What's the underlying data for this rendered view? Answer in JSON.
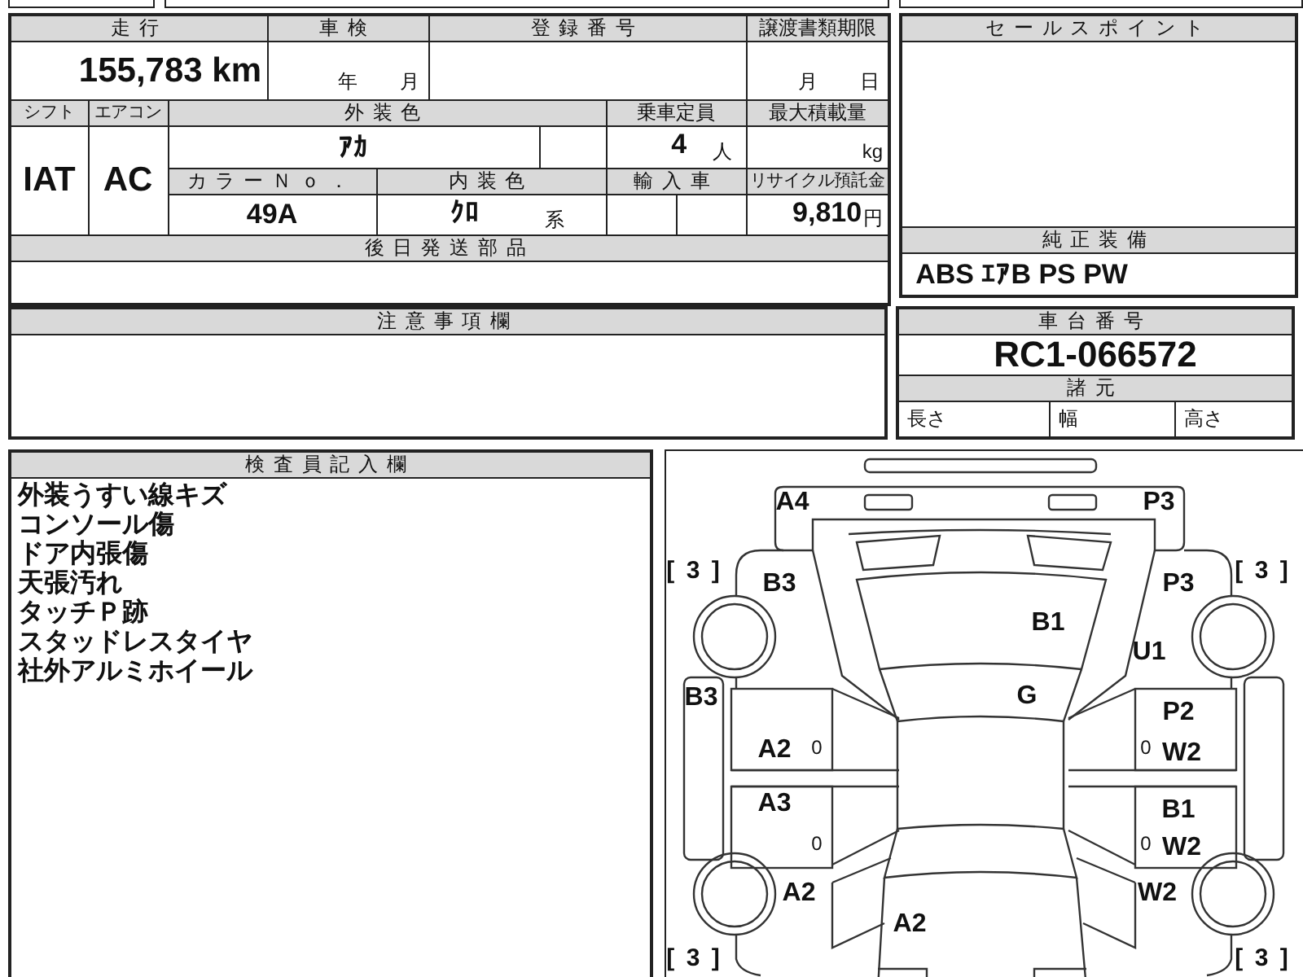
{
  "mileage": {
    "label": "走行",
    "value": "155,783 km"
  },
  "inspection": {
    "label": "車検",
    "year_unit": "年",
    "month_unit": "月"
  },
  "registration_number": {
    "label": "登録番号"
  },
  "transfer_deadline": {
    "label": "譲渡書類期限",
    "month_unit": "月",
    "day_unit": "日"
  },
  "shift": {
    "label": "シフト",
    "value": "IAT"
  },
  "air_conditioner": {
    "label": "エアコン",
    "value": "AC"
  },
  "exterior_color": {
    "label": "外装色",
    "value": "ｱｶ"
  },
  "capacity": {
    "label": "乗車定員",
    "value": "4",
    "unit": "人"
  },
  "max_load": {
    "label": "最大積載量",
    "unit": "kg"
  },
  "color_number": {
    "label": "カラーＮｏ．",
    "value": "49A"
  },
  "interior_color": {
    "label": "内装色",
    "value": "ｸﾛ",
    "suffix": "系"
  },
  "imported": {
    "label": "輸入車"
  },
  "recycling_fee": {
    "label": "リサイクル預託金",
    "value": "9,810",
    "unit": "円"
  },
  "later_shipped_parts": {
    "label": "後日発送部品"
  },
  "sales_points": {
    "label": "セールスポイント"
  },
  "standard_equipment": {
    "label": "純正装備",
    "value": "ABS ｴｱB PS PW"
  },
  "notes": {
    "label": "注意事項欄"
  },
  "chassis_number": {
    "label": "車台番号",
    "value": "RC1-066572"
  },
  "specifications": {
    "label": "諸元",
    "items": [
      "長さ",
      "幅",
      "高さ"
    ]
  },
  "inspector_notes": {
    "label": "検査員記入欄",
    "lines": [
      "外装うすい線キズ",
      "コンソール傷",
      "ドア内張傷",
      "天張汚れ",
      "タッチＰ跡",
      "スタッドレスタイヤ",
      "社外アルミホイール"
    ]
  },
  "damage_diagram": {
    "marks": [
      {
        "kind": "code",
        "text": "A4"
      },
      {
        "kind": "code",
        "text": "P3"
      },
      {
        "kind": "tread",
        "text": "[ 3 ]"
      },
      {
        "kind": "code",
        "text": "B3"
      },
      {
        "kind": "tread",
        "text": "[ 3 ]"
      },
      {
        "kind": "code",
        "text": "P3"
      },
      {
        "kind": "code",
        "text": "B1"
      },
      {
        "kind": "code",
        "text": "U1"
      },
      {
        "kind": "code",
        "text": "B3"
      },
      {
        "kind": "code",
        "text": "G"
      },
      {
        "kind": "code",
        "text": "P2"
      },
      {
        "kind": "code",
        "text": "A2"
      },
      {
        "kind": "small",
        "text": "0"
      },
      {
        "kind": "small",
        "text": "0"
      },
      {
        "kind": "code",
        "text": "W2"
      },
      {
        "kind": "code",
        "text": "A3"
      },
      {
        "kind": "code",
        "text": "B1"
      },
      {
        "kind": "small",
        "text": "0"
      },
      {
        "kind": "small",
        "text": "0"
      },
      {
        "kind": "code",
        "text": "W2"
      },
      {
        "kind": "code",
        "text": "A2"
      },
      {
        "kind": "code",
        "text": "W2"
      },
      {
        "kind": "code",
        "text": "A2"
      },
      {
        "kind": "tread",
        "text": "[ 3 ]"
      },
      {
        "kind": "tread",
        "text": "[ 3 ]"
      }
    ]
  }
}
